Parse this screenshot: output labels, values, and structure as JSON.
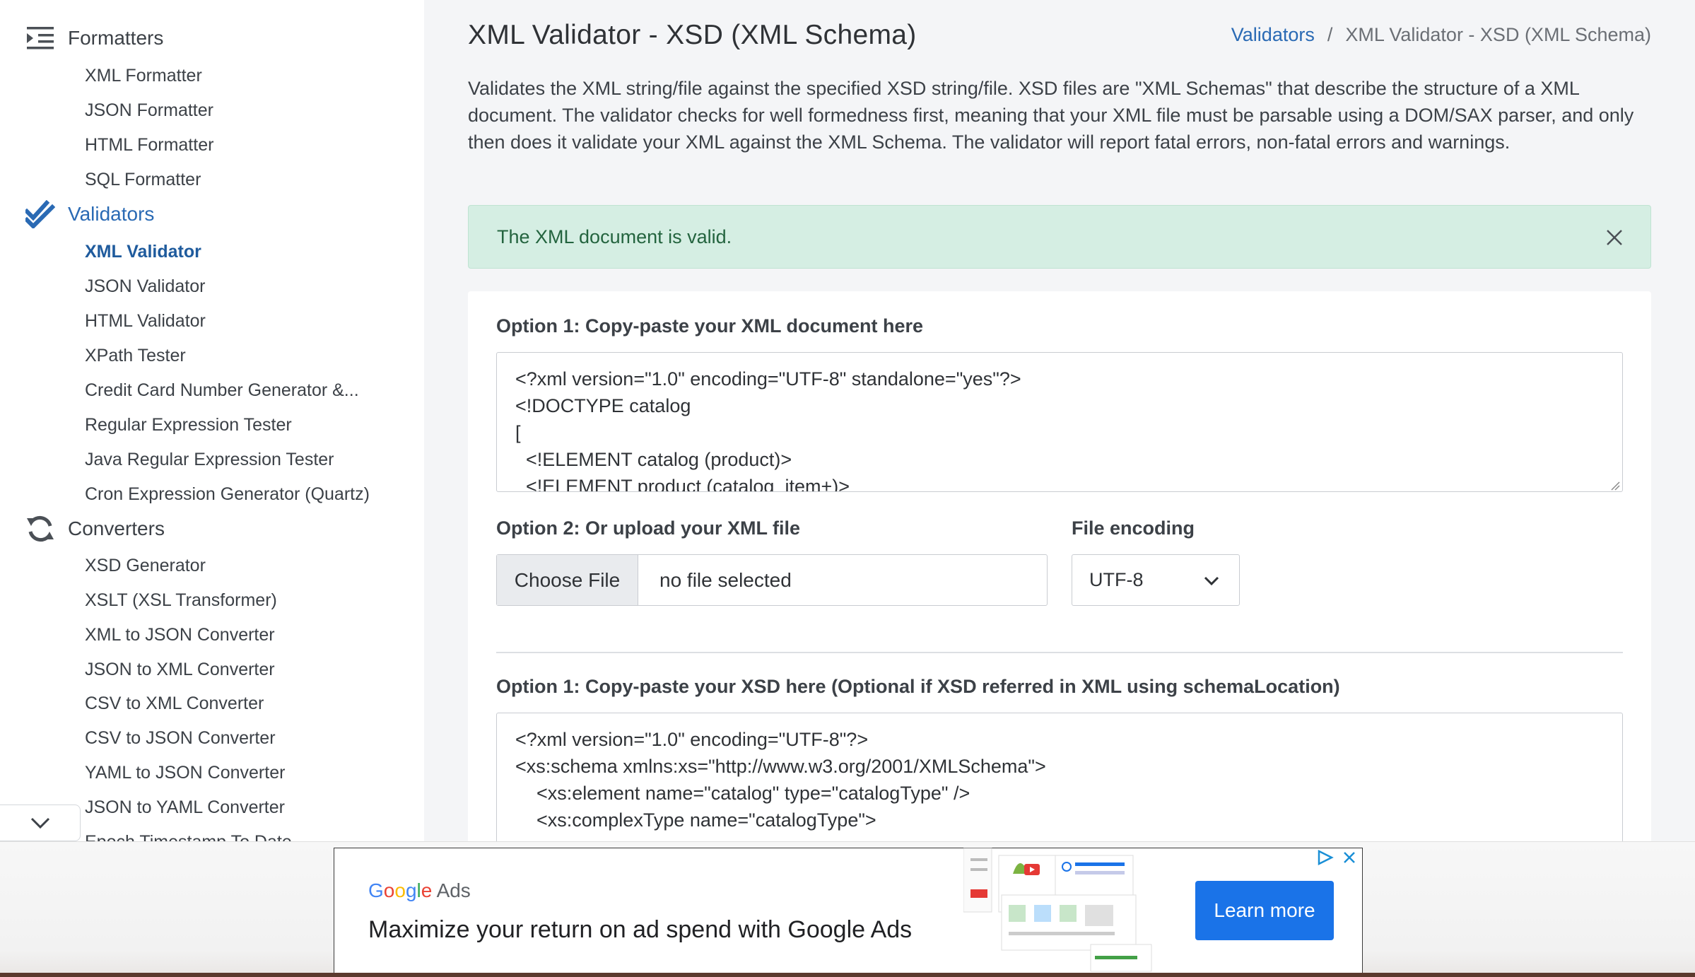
{
  "sidebar": {
    "sections": [
      {
        "label": "Formatters",
        "icon": "indent-list-icon"
      },
      {
        "label": "Validators",
        "icon": "double-check-icon"
      },
      {
        "label": "Converters",
        "icon": "refresh-arrows-icon"
      }
    ],
    "formatters": [
      "XML Formatter",
      "JSON Formatter",
      "HTML Formatter",
      "SQL Formatter"
    ],
    "validators": [
      "XML Validator",
      "JSON Validator",
      "HTML Validator",
      "XPath Tester",
      "Credit Card Number Generator &...",
      "Regular Expression Tester",
      "Java Regular Expression Tester",
      "Cron Expression Generator (Quartz)"
    ],
    "converters": [
      "XSD Generator",
      "XSLT (XSL Transformer)",
      "XML to JSON Converter",
      "JSON to XML Converter",
      "CSV to XML Converter",
      "CSV to JSON Converter",
      "YAML to JSON Converter",
      "JSON to YAML Converter",
      "Epoch Timestamp To Date"
    ]
  },
  "main": {
    "title": "XML Validator - XSD (XML Schema)",
    "breadcrumb": {
      "parent": "Validators",
      "separator": "/",
      "current": "XML Validator - XSD (XML Schema)"
    },
    "description": "Validates the XML string/file against the specified XSD string/file. XSD files are \"XML Schemas\" that describe the structure of a XML document. The validator checks for well formedness first, meaning that your XML file must be parsable using a DOM/SAX parser, and only then does it validate your XML against the XML Schema. The validator will report fatal errors, non-fatal errors and warnings.",
    "alert": "The XML document is valid.",
    "xml_option1_label": "Option 1: Copy-paste your XML document here",
    "xml_text": "<?xml version=\"1.0\" encoding=\"UTF-8\" standalone=\"yes\"?>\n<!DOCTYPE catalog\n[\n  <!ELEMENT catalog (product)>\n  <!ELEMENT product (catalog_item+)>",
    "xml_option2_label": "Option 2: Or upload your XML file",
    "file_button": "Choose File",
    "file_status": "no file selected",
    "encoding_label": "File encoding",
    "encoding_value": "UTF-8",
    "xsd_option1_label": "Option 1: Copy-paste your XSD here (Optional if XSD referred in XML using schemaLocation)",
    "xsd_text": "<?xml version=\"1.0\" encoding=\"UTF-8\"?>\n<xs:schema xmlns:xs=\"http://www.w3.org/2001/XMLSchema\">\n    <xs:element name=\"catalog\" type=\"catalogType\" />\n    <xs:complexType name=\"catalogType\">"
  },
  "ad": {
    "logo_google": [
      "G",
      "o",
      "o",
      "g",
      "l",
      "e"
    ],
    "logo_ads": "Ads",
    "headline": "Maximize your return on ad spend with Google Ads",
    "cta": "Learn more"
  },
  "colors": {
    "accent": "#2a6ab4",
    "alert_bg": "#d5eee3",
    "alert_text": "#24643f",
    "cta_bg": "#1a73e8"
  }
}
